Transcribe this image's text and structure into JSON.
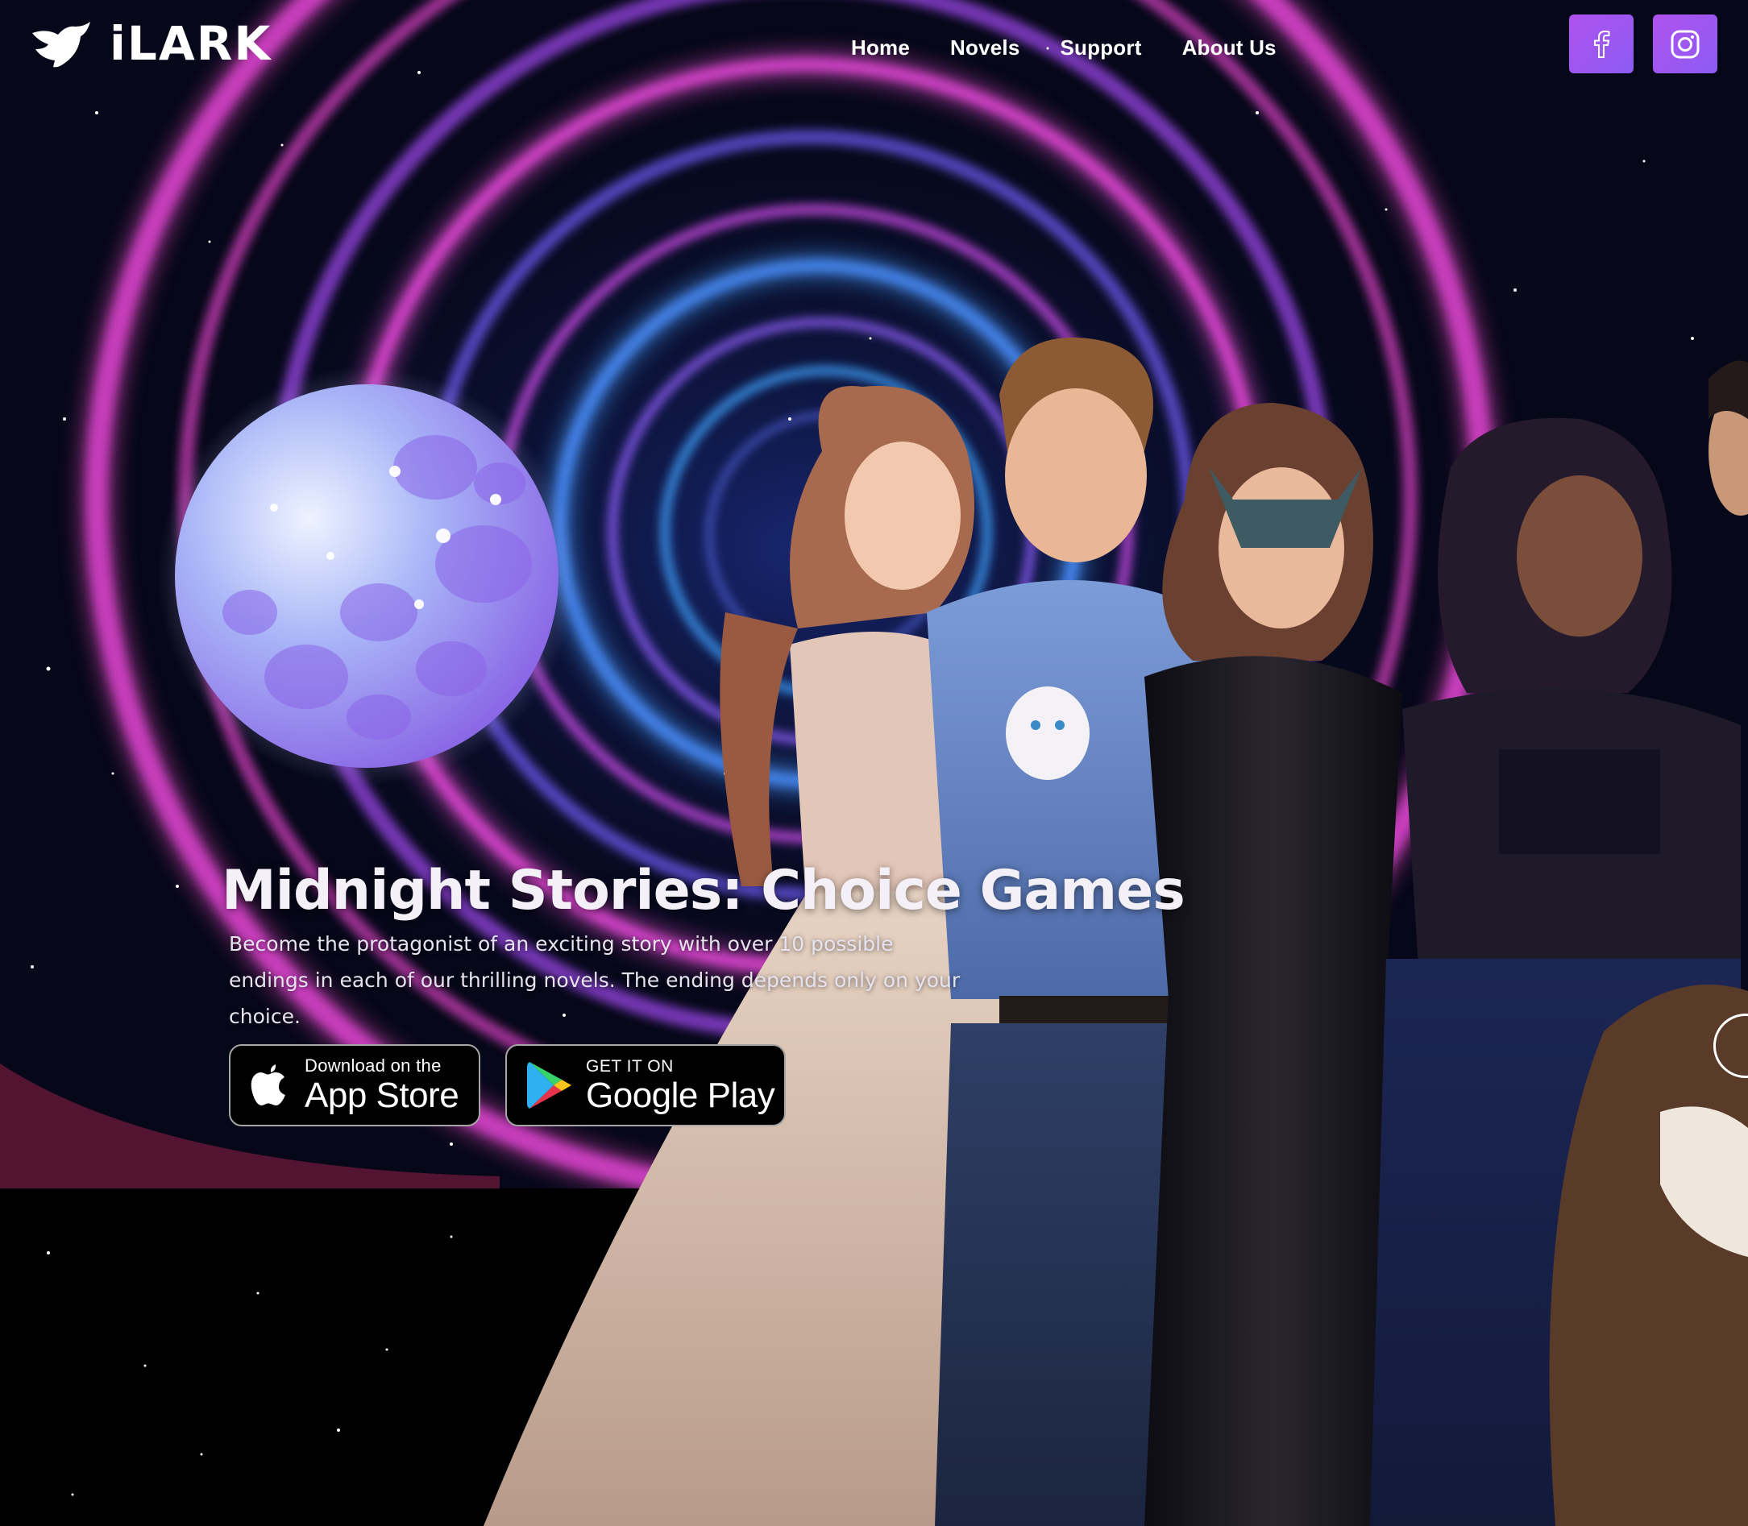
{
  "brand": {
    "name": "iLARK",
    "logo_icon": "bird-logo-icon"
  },
  "nav": {
    "items": [
      "Home",
      "Novels",
      "Support",
      "About Us"
    ]
  },
  "social": {
    "facebook_icon": "facebook-icon",
    "instagram_icon": "instagram-icon",
    "button_color": "#a35af0"
  },
  "hero": {
    "title": "Midnight Stories: Choice Games",
    "description": "Become the protagonist of an exciting story with over 10 possible endings in each of our thrilling novels. The ending depends only on your choice."
  },
  "stores": {
    "appstore": {
      "small": "Download on the",
      "big": "App Store",
      "icon": "apple-icon"
    },
    "googleplay": {
      "small": "GET IT ON",
      "big": "Google Play",
      "icon": "google-play-icon"
    }
  },
  "colors": {
    "background": "#03030a",
    "accent_purple": "#a35af0",
    "vortex_magenta": "#d53cd8",
    "vortex_blue": "#3c7cf0"
  }
}
